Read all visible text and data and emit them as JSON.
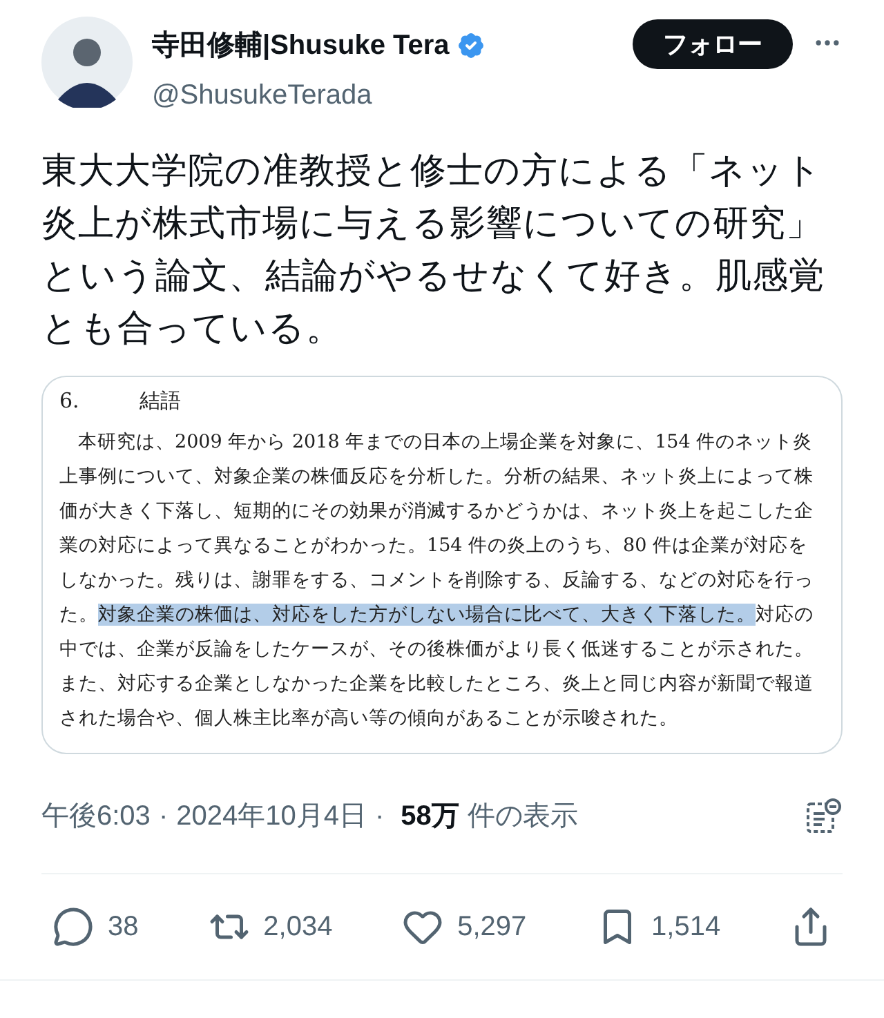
{
  "author": {
    "name": "寺田修輔|Shusuke Tera",
    "verified": true,
    "handle": "@ShusukeTerada"
  },
  "follow_button": "フォロー",
  "tweet_text": "東大大学院の准教授と修士の方による「ネット炎上が株式市場に与える影響についての研究」という論文、結論がやるせなくて好き。肌感覚とも合っている。",
  "document": {
    "section_number": "6.",
    "section_title": "結語",
    "paragraph": [
      {
        "text": "本研究は、2009 年から 2018 年までの日本の上場企業を対象に、154 件のネット炎上事例について、対象企業の株価反応を分析した。分析の結果、ネット炎上によって株価が大きく下落し、短期的にその効果が消滅するかどうかは、ネット炎上を起こした企業の対応によって異なることがわかった。154 件の炎上のうち、80 件は企業が対応をしなかった。残りは、謝罪をする、コメントを削除する、反論する、などの対応を行った。",
        "highlighted": false
      },
      {
        "text": "対象企業の株価は、対応をした方がしない場合に比べて、大きく下落した。",
        "highlighted": true
      },
      {
        "text": "対応の中では、企業が反論をしたケースが、その後株価がより長く低迷することが示された。また、対応する企業としなかった企業を比較したところ、炎上と同じ内容が新聞で報道された場合や、個人株主比率が高い等の傾向があることが示唆された。",
        "highlighted": false
      }
    ]
  },
  "meta": {
    "time": "午後6:03",
    "separator": "·",
    "date": "2024年10月4日",
    "views_count": "58万",
    "views_label": "件の表示"
  },
  "actions": [
    {
      "kind": "reply",
      "count": "38"
    },
    {
      "kind": "repost",
      "count": "2,034"
    },
    {
      "kind": "like",
      "count": "5,297"
    },
    {
      "kind": "bookmark",
      "count": "1,514"
    },
    {
      "kind": "share"
    }
  ]
}
